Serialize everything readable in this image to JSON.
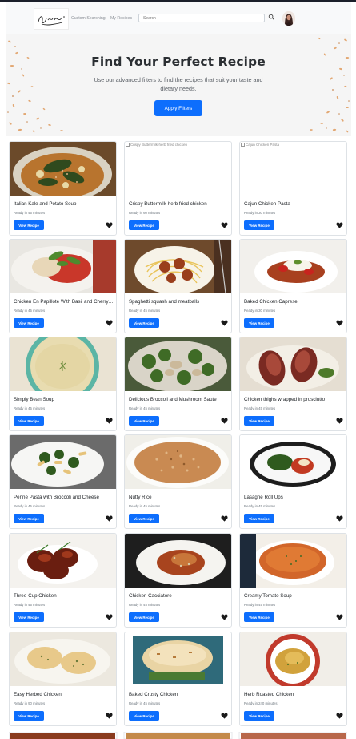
{
  "navbar": {
    "logo_alt": "Recipe Book logo",
    "links": [
      "Custom Searching",
      "My Recipes"
    ],
    "search": {
      "placeholder": "Search",
      "value": ""
    }
  },
  "hero": {
    "title": "Find Your Perfect Recipe",
    "subtitle": "Use our advanced filters to find the recipes that suit your taste and dietary needs.",
    "button_label": "Apply Filters"
  },
  "card_button_label": "View Recipe",
  "recipes": [
    {
      "title": "Italian Kale and Potato Soup",
      "ready": "Ready in 45 minutes",
      "image_alt": "",
      "image": "soup-kale"
    },
    {
      "title": "Crispy Buttermilk-herb fried chicken",
      "ready": "Ready in 60 minutes",
      "image_alt": "Crispy Buttermilk-herb fried chicken",
      "image": "broken"
    },
    {
      "title": "Cajun Chicken Pasta",
      "ready": "Ready in 30 minutes",
      "image_alt": "Cajun Chicken Pasta",
      "image": "broken"
    },
    {
      "title": "Chicken En Papillote With Basil and Cherry Tomatoes",
      "ready": "Ready in 45 minutes",
      "image_alt": "",
      "image": "papillote"
    },
    {
      "title": "Spaghetti squash and meatballs",
      "ready": "Ready in 45 minutes",
      "image_alt": "",
      "image": "meatballs"
    },
    {
      "title": "Baked Chicken Caprese",
      "ready": "Ready in 30 minutes",
      "image_alt": "",
      "image": "caprese"
    },
    {
      "title": "Simply Bean Soup",
      "ready": "Ready in 45 minutes",
      "image_alt": "",
      "image": "bean-soup"
    },
    {
      "title": "Delicious Broccoli and Mushroom Saute",
      "ready": "Ready in 45 minutes",
      "image_alt": "",
      "image": "broccoli"
    },
    {
      "title": "Chicken thighs wrapped in prosciutto",
      "ready": "Ready in 45 minutes",
      "image_alt": "",
      "image": "prosciutto"
    },
    {
      "title": "Penne Pasta with Broccoli and Cheese",
      "ready": "Ready in 45 minutes",
      "image_alt": "",
      "image": "penne"
    },
    {
      "title": "Nutty Rice",
      "ready": "Ready in 45 minutes",
      "image_alt": "",
      "image": "rice"
    },
    {
      "title": "Lasagne Roll Ups",
      "ready": "Ready in 45 minutes",
      "image_alt": "",
      "image": "lasagne"
    },
    {
      "title": "Three-Cup Chicken",
      "ready": "Ready in 45 minutes",
      "image_alt": "",
      "image": "three-cup"
    },
    {
      "title": "Chicken Cacciatore",
      "ready": "Ready in 45 minutes",
      "image_alt": "",
      "image": "cacciatore"
    },
    {
      "title": "Creamy Tomato Soup",
      "ready": "Ready in 45 minutes",
      "image_alt": "",
      "image": "tomato-soup"
    },
    {
      "title": "Easy Herbed Chicken",
      "ready": "Ready in 90 minutes",
      "image_alt": "",
      "image": "herbed"
    },
    {
      "title": "Baked Crusty Chicken",
      "ready": "Ready in 45 minutes",
      "image_alt": "",
      "image": "crusty"
    },
    {
      "title": "Herb Roasted Chicken",
      "ready": "Ready in 240 minutes",
      "image_alt": "",
      "image": "roasted"
    }
  ],
  "colors": {
    "primary": "#0d6efd",
    "navbar_bg": "#f8f9fa",
    "hero_bg": "#f5f5f5",
    "text": "#212529",
    "muted": "#6c757d"
  },
  "icons": {
    "search": "search-icon",
    "favorite": "heart-icon"
  }
}
